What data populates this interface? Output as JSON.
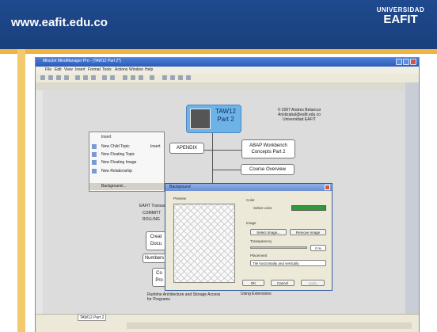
{
  "slide": {
    "url": "www.eafit.edu.co",
    "logo_line1": "UNIVERSIDAD",
    "logo_line2": "EAFIT"
  },
  "window": {
    "title": "MindJet MindManager Pro - [TAW12 Part 2*]",
    "menu": [
      "File",
      "Edit",
      "View",
      "Insert",
      "Format",
      "Tools",
      "Actions",
      "Window",
      "Help"
    ],
    "tab": "TAW12 Part 2"
  },
  "map": {
    "central_topic": "TAW12 Part 2",
    "copyright": [
      "© 2007 Andres Betancur",
      "Aristizabal@eafit.edu.co",
      "Universidad EAFIT"
    ],
    "topics": [
      "APENDIX",
      "ABAP Workbench Concepts Part 2",
      "Course Overview",
      "Numbers"
    ],
    "partial": [
      "EAFIT Transac",
      "COMMITT",
      "ROLLING",
      "Creat",
      "Docu",
      "Co",
      "Pro",
      "Runtime Architecture and Storage Access for Programs",
      "Using Extensions"
    ]
  },
  "context_menu": {
    "items": [
      "Insert",
      "New Child Topic",
      "New Floating Topic",
      "New Floating Image",
      "New Relationship",
      "Background..."
    ],
    "shortcut": "Insert"
  },
  "dialog": {
    "title": "Background",
    "preview_label": "Preview",
    "color_label": "Color",
    "color_value": "Select color",
    "image_label": "Image",
    "select_image": "Select image...",
    "remove_image": "Remove image",
    "transparency_label": "Transparency",
    "transparency_value": "0 %",
    "placement_label": "Placement",
    "placement_value": "Tile horizontally and vertically",
    "ok": "OK",
    "cancel": "Cancel",
    "apply": "Apply",
    "swatch_color": "#2f9a3a"
  }
}
